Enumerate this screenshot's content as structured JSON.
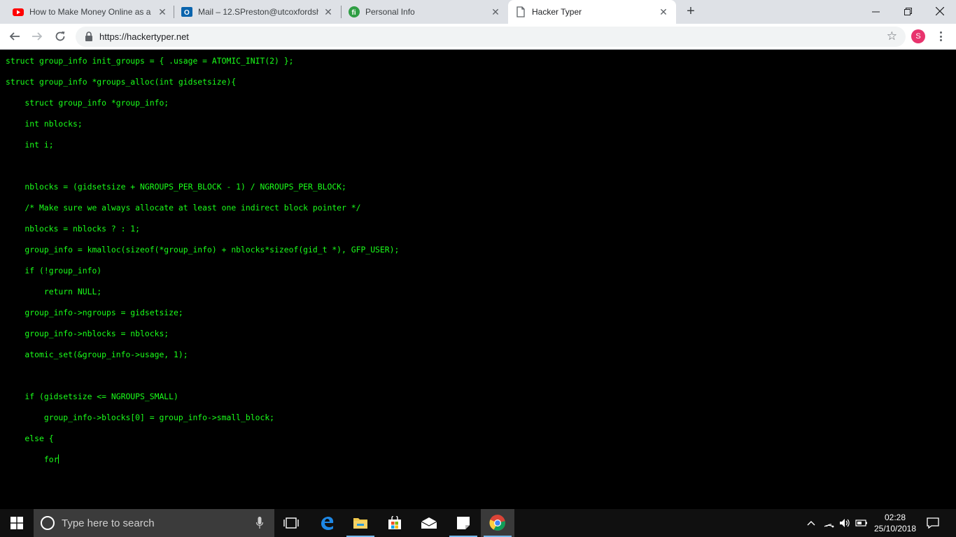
{
  "browser": {
    "tabs": [
      {
        "title": "How to Make Money Online as a",
        "favicon": "youtube-icon",
        "active": false
      },
      {
        "title": "Mail – 12.SPreston@utcoxfordsh",
        "favicon": "outlook-icon",
        "active": false
      },
      {
        "title": "Personal Info",
        "favicon": "green-circle-icon",
        "active": false
      },
      {
        "title": "Hacker Typer",
        "favicon": "document-icon",
        "active": true
      }
    ],
    "new_tab_label": "+",
    "url": "https://hackertyper.net",
    "profile_initial": "S",
    "colors": {
      "tabstrip": "#dee1e6",
      "profile": "#e8336d",
      "code_text": "#1aff1a"
    }
  },
  "page": {
    "code_lines": [
      "struct group_info init_groups = { .usage = ATOMIC_INIT(2) };",
      "struct group_info *groups_alloc(int gidsetsize){",
      "    struct group_info *group_info;",
      "    int nblocks;",
      "    int i;",
      "",
      "    nblocks = (gidsetsize + NGROUPS_PER_BLOCK - 1) / NGROUPS_PER_BLOCK;",
      "    /* Make sure we always allocate at least one indirect block pointer */",
      "    nblocks = nblocks ? : 1;",
      "    group_info = kmalloc(sizeof(*group_info) + nblocks*sizeof(gid_t *), GFP_USER);",
      "    if (!group_info)",
      "        return NULL;",
      "    group_info->ngroups = gidsetsize;",
      "    group_info->nblocks = nblocks;",
      "    atomic_set(&group_info->usage, 1);",
      "",
      "    if (gidsetsize <= NGROUPS_SMALL)",
      "        group_info->blocks[0] = group_info->small_block;",
      "    else {",
      "        for"
    ]
  },
  "taskbar": {
    "search_placeholder": "Type here to search",
    "time": "02:28",
    "date": "25/10/2018"
  }
}
